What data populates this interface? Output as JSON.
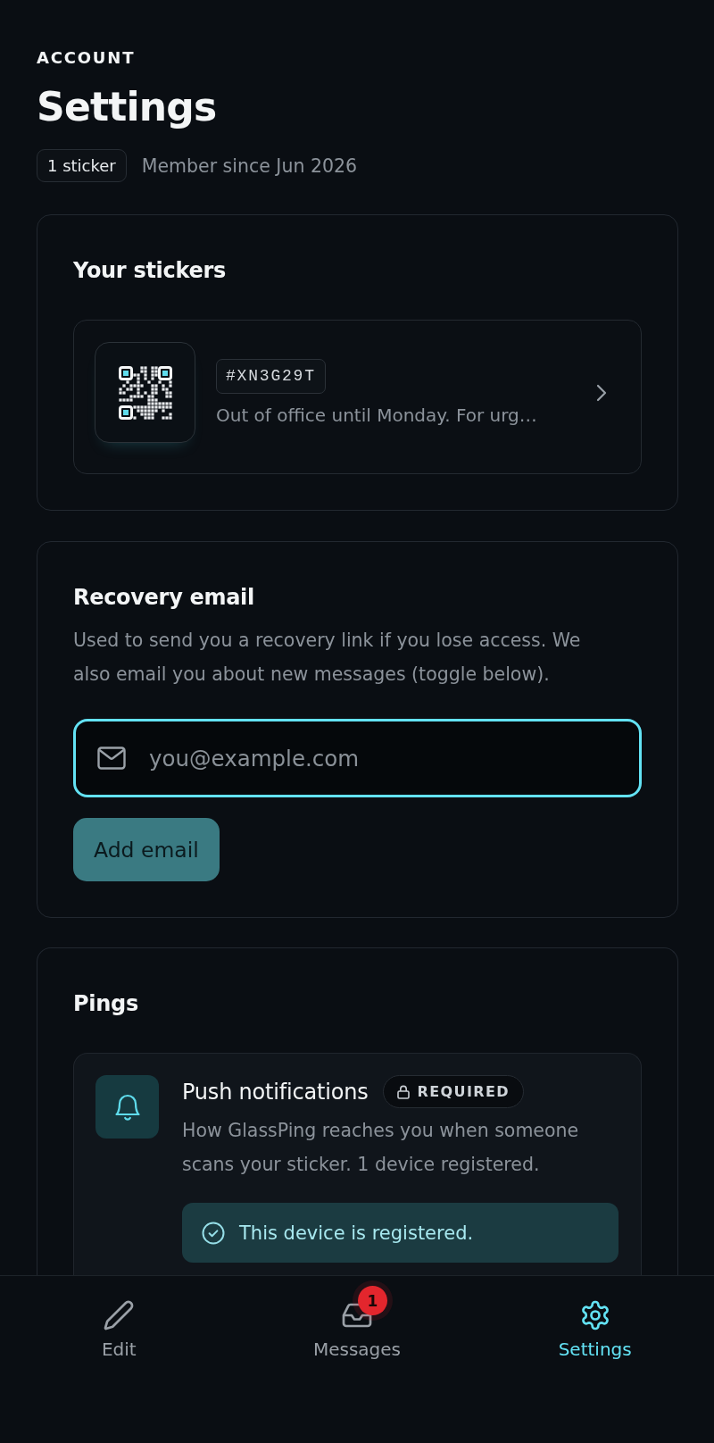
{
  "header": {
    "eyebrow": "ACCOUNT",
    "title": "Settings",
    "sticker_count": "1 sticker",
    "member_since": "Member since Jun 2026"
  },
  "stickers_section": {
    "title": "Your stickers",
    "stickers": [
      {
        "code": "#XN3G29T",
        "message": "Out of office until Monday. For urg…"
      }
    ]
  },
  "recovery_section": {
    "title": "Recovery email",
    "description": "Used to send you a recovery link if you lose access. We also email you about new messages (toggle below).",
    "email_field": {
      "placeholder": "you@example.com",
      "focused": true
    },
    "button": {
      "label": "Add email",
      "disabled": true
    }
  },
  "pings_section": {
    "title": "Pings",
    "items": [
      {
        "title": "Push notifications",
        "badge": "REQUIRED",
        "description": "How GlassPing reaches you when someone scans your sticker. 1 device registered.",
        "status": {
          "text": "This device is registered.",
          "registered": true
        }
      }
    ]
  },
  "bottom_nav": {
    "tabs": [
      {
        "label": "Edit",
        "selected": false
      },
      {
        "label": "Messages",
        "selected": false,
        "badge": "1"
      },
      {
        "label": "Settings",
        "selected": true
      }
    ]
  }
}
